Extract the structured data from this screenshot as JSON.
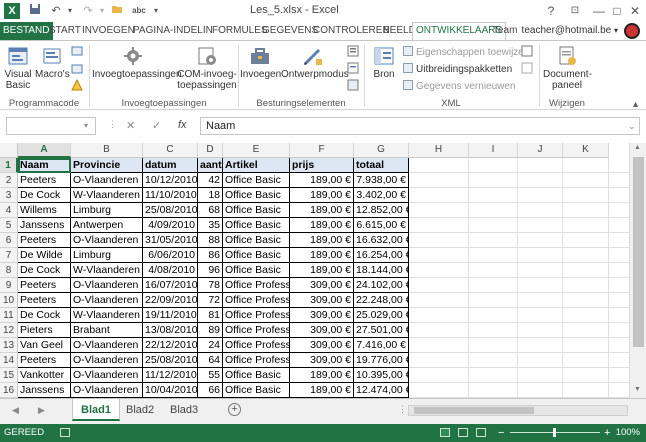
{
  "window": {
    "title": "Les_5.xlsx - Excel",
    "app_icon": "X",
    "quick_access": [
      "save-icon",
      "undo-icon",
      "redo-icon",
      "open-folder-icon",
      "spelling-icon"
    ],
    "spelling_label": "abc",
    "controls": [
      "?",
      "restore-ribbon-icon",
      "minimize-icon",
      "maximize-icon",
      "close-icon"
    ],
    "help": "?",
    "minimize": "—",
    "maximize": "□",
    "close": "✕",
    "ribbon_opts": "⊡"
  },
  "tabs": [
    "BESTAND",
    "START",
    "INVOEGEN",
    "PAGINA-INDELIN",
    "FORMULES",
    "GEGEVENS",
    "CONTROLEREN",
    "BEELD",
    "ONTWIKKELAARS",
    "Team"
  ],
  "active_tab": "ONTWIKKELAARS",
  "user": "teacher@hotmail.be",
  "ribbon": {
    "groups": [
      {
        "label": "Programmacode"
      },
      {
        "label": "Invoegtoepassingen"
      },
      {
        "label": "Besturingselementen"
      },
      {
        "label": "XML"
      },
      {
        "label": "Wijzigen"
      }
    ],
    "buttons": {
      "visual_basic": "Visual Basic",
      "visual_basic_l1": "Visual",
      "visual_basic_l2": "Basic",
      "macros": "Macro's",
      "invoegtoepassingen": "Invoegtoepassingen",
      "com_l1": "COM-invoeg-",
      "com_l2": "toepassingen",
      "invoegen": "Invoegen",
      "ontwerpmodus": "Ontwerpmodus",
      "bron": "Bron",
      "eigenschappen": "Eigenschappen toewijzen",
      "uitbreidingspakketten": "Uitbreidingspakketten",
      "gegevens_vernieuwen": "Gegevens vernieuwen",
      "document_l1": "Document-",
      "document_l2": "paneel"
    }
  },
  "formula_bar": {
    "name_box": "",
    "cancel": "✕",
    "confirm": "✓",
    "fx": "fx",
    "content": "Naam"
  },
  "grid": {
    "columns": [
      "A",
      "B",
      "C",
      "D",
      "E",
      "F",
      "G",
      "H",
      "I",
      "J",
      "K"
    ],
    "selected_column": "A",
    "selected_row": "1",
    "rows": [
      "1",
      "2",
      "3",
      "4",
      "5",
      "6",
      "7",
      "8",
      "9",
      "10",
      "11",
      "12",
      "13",
      "14",
      "15",
      "16",
      "17"
    ],
    "header": [
      "Naam",
      "Provincie",
      "datum",
      "aant",
      "Artikel",
      "prijs",
      "totaal"
    ],
    "data": [
      [
        "Peeters",
        "O-Vlaanderen",
        "10/12/2010",
        "42",
        "Office Basic",
        "189,00 €",
        "7.938,00 €"
      ],
      [
        "De Cock",
        "W-Vlaanderen",
        "11/10/2010",
        "18",
        "Office Basic",
        "189,00 €",
        "3.402,00 €"
      ],
      [
        "Willems",
        "Limburg",
        "25/08/2010",
        "68",
        "Office Basic",
        "189,00 €",
        "12.852,00 €"
      ],
      [
        "Janssens",
        "Antwerpen",
        "4/09/2010",
        "35",
        "Office Basic",
        "189,00 €",
        "6.615,00 €"
      ],
      [
        "Peeters",
        "O-Vlaanderen",
        "31/05/2010",
        "88",
        "Office Basic",
        "189,00 €",
        "16.632,00 €"
      ],
      [
        "De Wilde",
        "Limburg",
        "6/06/2010",
        "86",
        "Office Basic",
        "189,00 €",
        "16.254,00 €"
      ],
      [
        "De Cock",
        "W-Vlaanderen",
        "4/08/2010",
        "96",
        "Office Basic",
        "189,00 €",
        "18.144,00 €"
      ],
      [
        "Peeters",
        "O-Vlaanderen",
        "16/07/2010",
        "78",
        "Office Professi",
        "309,00 €",
        "24.102,00 €"
      ],
      [
        "Peeters",
        "O-Vlaanderen",
        "22/09/2010",
        "72",
        "Office Professi",
        "309,00 €",
        "22.248,00 €"
      ],
      [
        "De Cock",
        "W-Vlaanderen",
        "19/11/2010",
        "81",
        "Office Professi",
        "309,00 €",
        "25.029,00 €"
      ],
      [
        "Pieters",
        "Brabant",
        "13/08/2010",
        "89",
        "Office Professi",
        "309,00 €",
        "27.501,00 €"
      ],
      [
        "Van Geel",
        "O-Vlaanderen",
        "22/12/2010",
        "24",
        "Office Professi",
        "309,00 €",
        "7.416,00 €"
      ],
      [
        "Peeters",
        "O-Vlaanderen",
        "25/08/2010",
        "64",
        "Office Professi",
        "309,00 €",
        "19.776,00 €"
      ],
      [
        "Vankotter",
        "O-Vlaanderen",
        "11/12/2010",
        "55",
        "Office Basic",
        "189,00 €",
        "10.395,00 €"
      ],
      [
        "Janssens",
        "O-Vlaanderen",
        "10/04/2010",
        "66",
        "Office Basic",
        "189,00 €",
        "12.474,00 €"
      ]
    ]
  },
  "sheets": [
    "Blad1",
    "Blad2",
    "Blad3"
  ],
  "active_sheet": "Blad1",
  "status": {
    "ready": "GEREED",
    "zoom": "100%",
    "minus": "−",
    "plus": "+"
  },
  "colors": {
    "accent": "#217346",
    "header_fill": "#dde7f3"
  }
}
